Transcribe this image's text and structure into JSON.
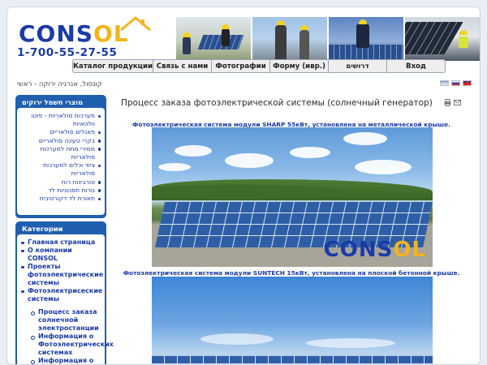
{
  "brand": {
    "logo_part1": "CONS",
    "logo_part2": "OL",
    "phone": "1-700-55-27-55",
    "accent_blue": "#1a3aa8",
    "accent_yellow": "#f2b41c"
  },
  "nav": {
    "items": [
      {
        "label": "Каталог продукции"
      },
      {
        "label": "Связь с нами"
      },
      {
        "label": "Фотографии"
      },
      {
        "label": "Форму (ивр.)"
      },
      {
        "label": "דרושים"
      },
      {
        "label": "Вход"
      }
    ]
  },
  "breadcrumb": "קונסול, אנרגיה ירוקה - ראשי",
  "languages": [
    {
      "name": "Hebrew"
    },
    {
      "name": "Russian"
    },
    {
      "name": "English"
    }
  ],
  "sidebar": {
    "products": {
      "title": "מוצרי חשמל ירוקים",
      "items": [
        {
          "label": "מערכות סולאריות - פוטו וולטאיות"
        },
        {
          "label": "פאנלים סולאריים"
        },
        {
          "label": "בקרי טעינה סולאריים"
        },
        {
          "label": "ממירי מתח למערכות סולאריות"
        },
        {
          "label": "ציוד וכלים למערכות סולאריות"
        },
        {
          "label": "טורבינות רוח"
        },
        {
          "label": "נורות חסכוניות לד"
        },
        {
          "label": "תאורת לד דקורטיבית"
        }
      ]
    },
    "categories": {
      "title": "Категории",
      "items": [
        {
          "label": "Главная страница",
          "level": 1
        },
        {
          "label": "О компании CONSOL",
          "level": 1
        },
        {
          "label": "Проекты фотоэлектрические системы",
          "level": 1
        },
        {
          "label": "Фотоэлектрисеские системы",
          "level": 1
        },
        {
          "label": "Процесс заказа солнечной электростанции",
          "level": 2
        },
        {
          "label": "Информация о Фотоэлектрических системах",
          "level": 2
        },
        {
          "label": "Информация о Фотоэлектрических",
          "level": 2
        }
      ]
    }
  },
  "main": {
    "title": "Процесс заказа фотоэлектрической системы (солнечный генератор)",
    "tools": [
      {
        "icon": "print-icon"
      },
      {
        "icon": "email-icon"
      }
    ],
    "figures": [
      {
        "caption": "Фотоэлектрическая система модули SHARP 55кВт, установлена на металлической крыше."
      },
      {
        "caption": "Фотоэлектрическая система модули SUNTECH 15кВт, установлена на плоской бетонной крыше."
      }
    ],
    "photo_logo_part1": "CONS",
    "photo_logo_part2": "OL"
  }
}
